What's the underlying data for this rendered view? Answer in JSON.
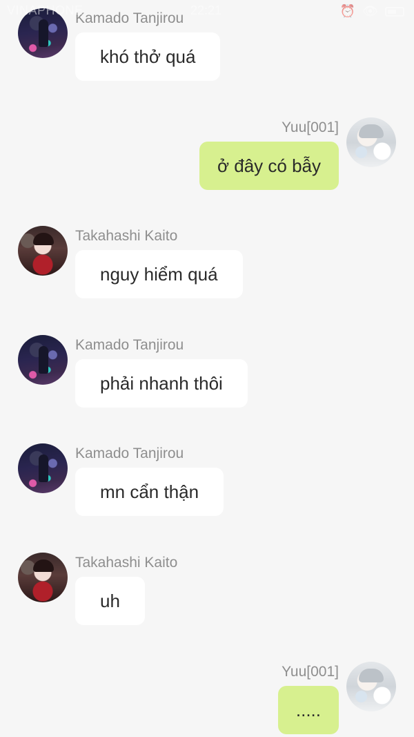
{
  "status_bar": {
    "carrier": "VINAPHONE",
    "time": "22:21",
    "icons": [
      "alarm-icon",
      "eye-icon",
      "battery-icon"
    ]
  },
  "messages": [
    {
      "side": "left",
      "sender": "Kamado Tanjirou",
      "avatar": "tanjirou-avatar",
      "text": "khó thở quá"
    },
    {
      "side": "right",
      "sender": "Yuu[001]",
      "avatar": "yuu-avatar",
      "text": "ở đây có bẫy"
    },
    {
      "side": "left",
      "sender": "Takahashi Kaito",
      "avatar": "kaito-avatar",
      "text": "nguy hiểm quá"
    },
    {
      "side": "left",
      "sender": "Kamado Tanjirou",
      "avatar": "tanjirou-avatar",
      "text": "phải nhanh thôi"
    },
    {
      "side": "left",
      "sender": "Kamado Tanjirou",
      "avatar": "tanjirou-avatar",
      "text": "mn cẩn thận"
    },
    {
      "side": "left",
      "sender": "Takahashi Kaito",
      "avatar": "kaito-avatar",
      "text": "uh"
    },
    {
      "side": "right",
      "sender": "Yuu[001]",
      "avatar": "yuu-avatar",
      "text": "....."
    }
  ],
  "colors": {
    "background": "#f6f6f6",
    "incoming_bubble": "#ffffff",
    "outgoing_bubble": "#d7f08f",
    "sender_name": "#8e8e8e"
  }
}
